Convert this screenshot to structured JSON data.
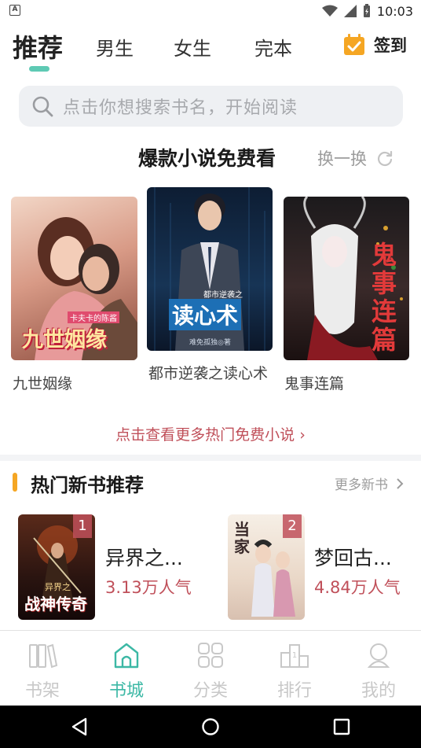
{
  "status_bar": {
    "time": "10:03",
    "left_icon": "A"
  },
  "tabs": [
    {
      "label": "推荐",
      "active": true
    },
    {
      "label": "男生",
      "active": false
    },
    {
      "label": "女生",
      "active": false
    },
    {
      "label": "完本",
      "active": false
    }
  ],
  "checkin": {
    "label": "签到",
    "icon": "calendar-check-icon",
    "color": "#f5a623"
  },
  "search": {
    "placeholder": "点击你想搜索书名，开始阅读",
    "icon": "search-icon"
  },
  "featured": {
    "title": "爆款小说免费看",
    "refresh_label": "换一换",
    "books": [
      {
        "title": "九世姻缘",
        "cover_text": "九世姻缘",
        "cover_subtitle": "卡夫卡的陈酱"
      },
      {
        "title": "都市逆袭之读心术",
        "cover_text": "读心术",
        "cover_subtitle": "都市逆袭之",
        "cover_author": "难免孤独◎著"
      },
      {
        "title": "鬼事连篇",
        "cover_text": "鬼事连篇"
      }
    ],
    "more_link": "点击查看更多热门免费小说 ›"
  },
  "hot_new": {
    "title": "热门新书推荐",
    "more_label": "更多新书",
    "books": [
      {
        "rank": "1",
        "name": "异界之...",
        "popularity": "3.13万人气",
        "cover_text": "战神传奇",
        "cover_sub": "异界之"
      },
      {
        "rank": "2",
        "name": "梦回古...",
        "popularity": "4.84万人气",
        "cover_text": "当家"
      }
    ]
  },
  "bottom_nav": [
    {
      "label": "书架",
      "icon": "bookshelf-icon",
      "active": false
    },
    {
      "label": "书城",
      "icon": "bookstore-icon",
      "active": true
    },
    {
      "label": "分类",
      "icon": "category-grid-icon",
      "active": false
    },
    {
      "label": "排行",
      "icon": "ranking-icon",
      "active": false
    },
    {
      "label": "我的",
      "icon": "profile-icon",
      "active": false
    }
  ],
  "colors": {
    "accent": "#3cb8a5",
    "highlight": "#c0505a",
    "section_bar": "#f5a623"
  }
}
